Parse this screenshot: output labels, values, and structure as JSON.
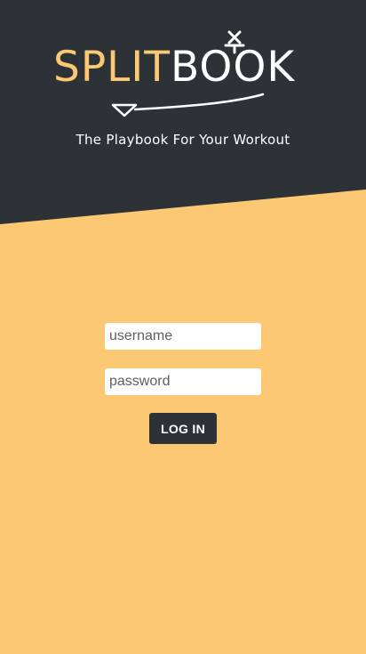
{
  "brand": {
    "logo_split": "SPLIT",
    "logo_book": "BOOK",
    "tagline": "The Playbook For Your Workout"
  },
  "login": {
    "username_placeholder": "username",
    "username_value": "",
    "password_placeholder": "password",
    "password_value": "",
    "submit_label": "LOG IN"
  },
  "colors": {
    "header_bg": "#2c3236",
    "accent": "#fcc874",
    "logo_book": "#ffffff",
    "button_bg": "#2c3236",
    "button_text": "#ffffff"
  }
}
